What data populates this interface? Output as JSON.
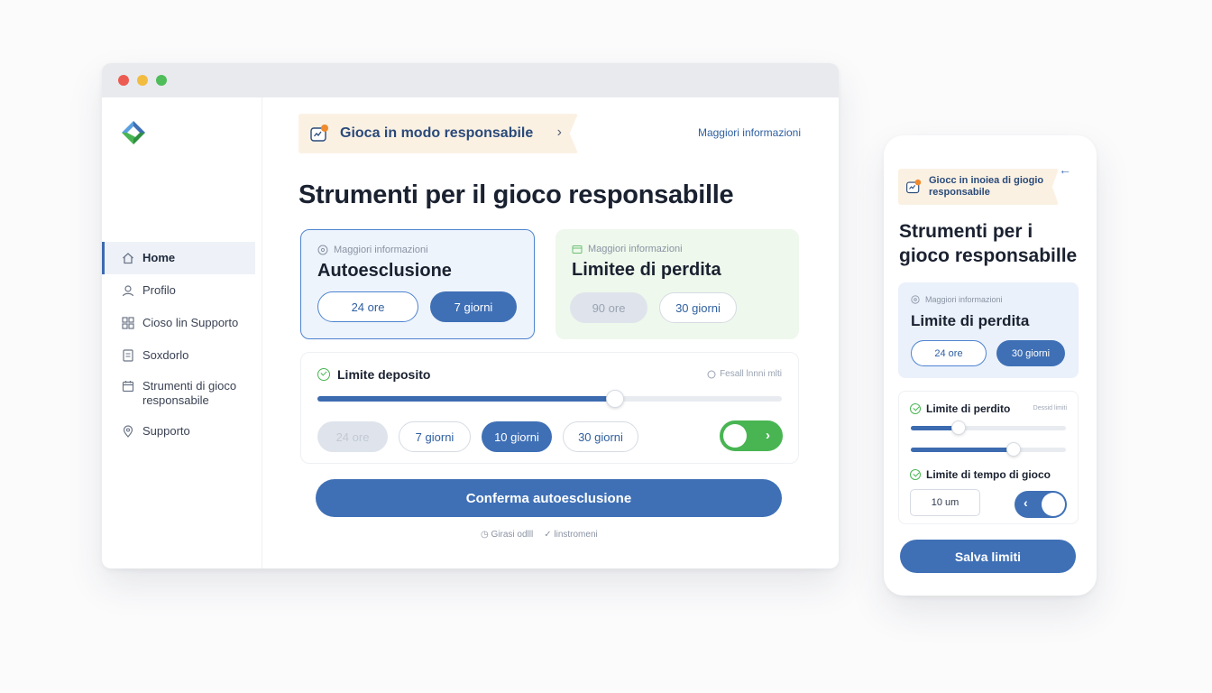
{
  "desktop": {
    "sidebar": {
      "items": [
        {
          "label": "Home",
          "icon": "home-icon"
        },
        {
          "label": "Profilo",
          "icon": "user-icon"
        },
        {
          "label": "Cioso lin Supporto",
          "icon": "grid-icon"
        },
        {
          "label": "Soxdorlo",
          "icon": "document-icon"
        },
        {
          "label": "Strumenti di gioco responsabile",
          "icon": "calendar-icon"
        },
        {
          "label": "Supporto",
          "icon": "location-pin-icon"
        }
      ]
    },
    "banner": {
      "label": "Gioca in modo responsabile"
    },
    "more_info_link": "Maggiori informazioni",
    "page_title": "Strumenti per il gioco responsabille",
    "card_self_exclusion": {
      "info": "Maggiori informazioni",
      "title": "Autoesclusione",
      "options": [
        "24 ore",
        "7 giorni"
      ],
      "selected": "7 giorni"
    },
    "card_loss_limit": {
      "info": "Maggiori informazioni",
      "title": "Limitee di perdita",
      "options": [
        "90 ore",
        "30 giorni"
      ]
    },
    "deposit": {
      "title": "Limite deposito",
      "aside": "Fesall lnnni mlti",
      "slider_level": 0.64,
      "options": [
        "24 ore",
        "7 giorni",
        "10 giorni",
        "30 giorni"
      ],
      "selected": "10 giorni",
      "toggle_on": true
    },
    "confirm_button": "Conferma autoesclusione",
    "footer": {
      "left": "Girasi odlll",
      "right": "linstromeni"
    }
  },
  "mobile": {
    "banner": {
      "label": "Giocc in inoiea di giogio responsabile"
    },
    "title": "Strumenti per i gioco responsabille",
    "card": {
      "info": "Maggiori informazioni",
      "title": "Limite di perdita",
      "options": [
        "24 ore",
        "30 giorni"
      ],
      "selected": "30 giorni"
    },
    "loss_limit": {
      "title": "Limite di perdito",
      "aside": "Dessid limiti",
      "slider_1_level": 0.31,
      "slider_2_level": 0.66
    },
    "time_limit": {
      "title": "Limite di tempo di gioco",
      "input_value": "10 um"
    },
    "save_button": "Salva limiti"
  },
  "colors": {
    "accent": "#3f70b6",
    "success": "#48b552",
    "banner_bg": "#fbf1e3"
  }
}
